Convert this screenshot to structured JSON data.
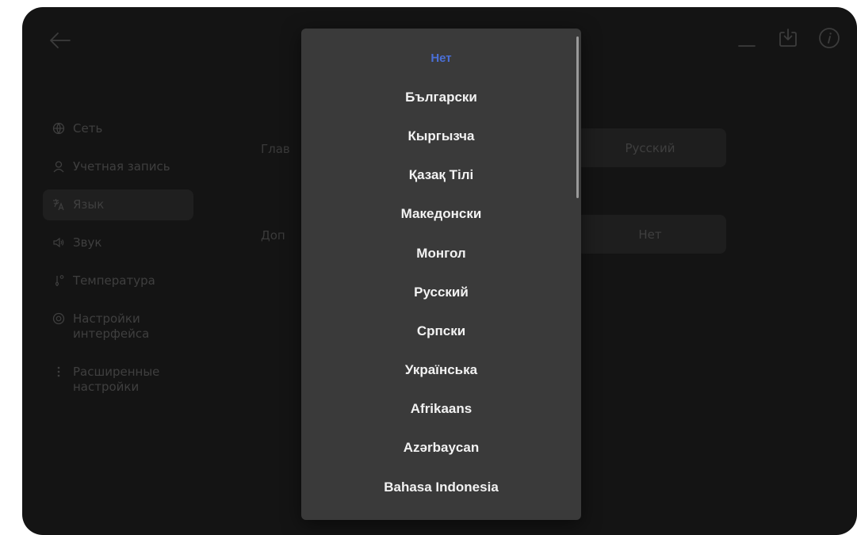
{
  "icons": {
    "back": "arrow-left-icon",
    "minimize": "minimize-icon",
    "download": "download-icon",
    "info": "info-icon"
  },
  "sidebar": {
    "items": [
      {
        "label": "Сеть",
        "icon": "globe-icon",
        "active": false
      },
      {
        "label": "Учетная запись",
        "icon": "user-icon",
        "active": false
      },
      {
        "label": "Язык",
        "icon": "translate-icon",
        "active": true
      },
      {
        "label": "Звук",
        "icon": "speaker-icon",
        "active": false
      },
      {
        "label": "Температура",
        "icon": "thermometer-icon",
        "active": false
      },
      {
        "label": "Настройки\nинтерфейса",
        "icon": "settings-icon",
        "active": false
      },
      {
        "label": "Расширенные\nнастройки",
        "icon": "more-vertical-icon",
        "active": false
      }
    ]
  },
  "main": {
    "primary_label": "Глав",
    "primary_value": "Русский",
    "secondary_label": "Доп",
    "secondary_value": "Нет"
  },
  "dropdown": {
    "selected": "Нет",
    "options": [
      "Нет",
      "Български",
      "Кыргызча",
      "Қазақ Тілі",
      "Македонски",
      "Монгол",
      "Русский",
      "Српски",
      "Українська",
      "Afrikaans",
      "Azərbaycan",
      "Bahasa Indonesia"
    ],
    "scroll_position": 0.0,
    "scroll_visible_fraction": 0.34
  },
  "colors": {
    "background": "#141414",
    "dropdown_bg": "#3a3a3a",
    "selected_option": "#4a6fd6",
    "option_text": "#f2f2f2"
  }
}
